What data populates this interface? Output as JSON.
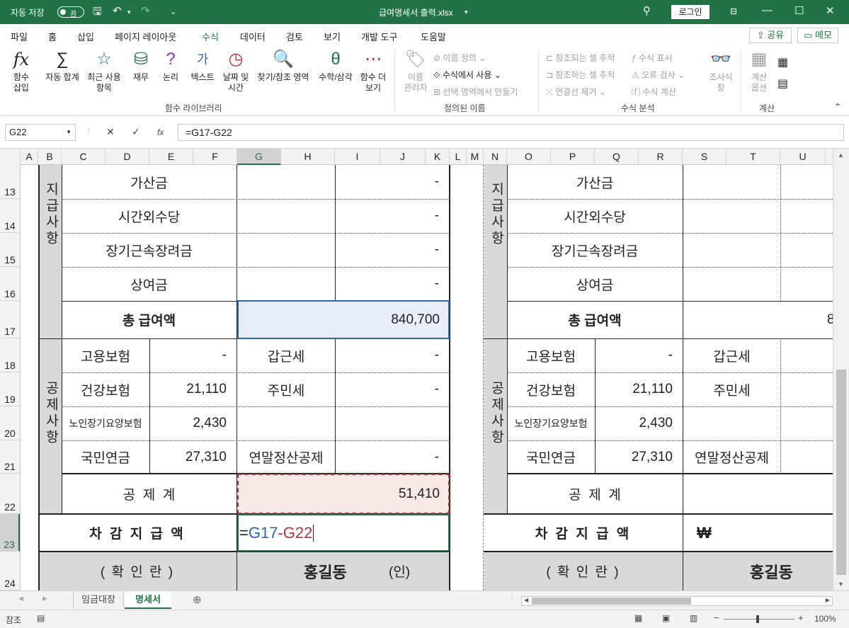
{
  "title_bar": {
    "autosave_label": "자동 저장",
    "autosave_state": "끔",
    "file_name": "급여명세서 출력.xlsx",
    "login_label": "로그인"
  },
  "menu": {
    "tabs": [
      "파일",
      "홈",
      "삽입",
      "페이지 레이아웃",
      "수식",
      "데이터",
      "검토",
      "보기",
      "개발 도구",
      "도움말"
    ],
    "active": "수식",
    "share_label": "공유",
    "memo_label": "메모"
  },
  "ribbon": {
    "function_library": {
      "insert_function": "함수\n삽입",
      "autosum": "자동 합계",
      "recent": "최근 사용\n항목",
      "financial": "재무",
      "logical": "논리",
      "text": "텍스트",
      "datetime": "날짜 및\n시간",
      "lookup": "찾기/참조 영역",
      "math": "수학/삼각",
      "more": "함수 더\n보기",
      "label": "함수 라이브러리"
    },
    "defined_names": {
      "name_manager": "이름\n관리자",
      "define_name": "이름 정의",
      "use_in_formula": "수식에서 사용",
      "create_from_selection": "선택 영역에서 만들기",
      "label": "정의된 이름"
    },
    "formula_auditing": {
      "trace_precedents": "참조되는 셀 추적",
      "trace_dependents": "참조하는 셀 추적",
      "remove_arrows": "연결선 제거",
      "show_formulas": "수식 표시",
      "error_checking": "오류 검사",
      "evaluate_formula": "수식 계산",
      "watch_window": "조사식\n창",
      "label": "수식 분석"
    },
    "calculation": {
      "options": "계산\n옵션",
      "label": "계산"
    }
  },
  "formula_bar": {
    "name_box": "G22",
    "formula": "=G17-G22"
  },
  "columns": [
    "A",
    "B",
    "C",
    "D",
    "E",
    "F",
    "G",
    "H",
    "I",
    "J",
    "K",
    "L",
    "M",
    "N",
    "O",
    "P",
    "Q",
    "R",
    "S",
    "T",
    "U"
  ],
  "rows": [
    "13",
    "14",
    "15",
    "16",
    "17",
    "18",
    "19",
    "20",
    "21",
    "22",
    "23",
    "24"
  ],
  "sheet": {
    "left": {
      "sec_pay": "지급사항",
      "sec_ded": "공제사항",
      "r13_label": "가산금",
      "r13_val": "-",
      "r14_label": "시간외수당",
      "r14_val": "-",
      "r15_label": "장기근속장려금",
      "r15_val": "-",
      "r16_label": "상여금",
      "r16_val": "-",
      "r17_label": "총 급여액",
      "r17_val": "840,700",
      "r18_l1": "고용보험",
      "r18_v1": "-",
      "r18_l2": "갑근세",
      "r18_v2": "-",
      "r19_l1": "건강보험",
      "r19_v1": "21,110",
      "r19_l2": "주민세",
      "r19_v2": "-",
      "r20_l1": "노인장기요양보험",
      "r20_v1": "2,430",
      "r21_l1": "국민연금",
      "r21_v1": "27,310",
      "r21_l2": "연말정산공제",
      "r21_v2": "-",
      "r22_label": "공  제  계",
      "r22_val": "51,410",
      "r23_label": "차 감 지 급 액",
      "r24_label": "( 확 인 란 )",
      "r24_name": "홍길동",
      "r24_seal": "(인)"
    },
    "edit_ref1": "G17",
    "edit_ref2": "G22",
    "right": {
      "sec_pay": "지급사항",
      "sec_ded": "공제사항",
      "r13_label": "가산금",
      "r14_label": "시간외수당",
      "r15_label": "장기근속장려금",
      "r16_label": "상여금",
      "r17_label": "총 급여액",
      "r17_val": "8",
      "r18_l1": "고용보험",
      "r18_v1": "-",
      "r18_l2": "갑근세",
      "r19_l1": "건강보험",
      "r19_v1": "21,110",
      "r19_l2": "주민세",
      "r20_l1": "노인장기요양보험",
      "r20_v1": "2,430",
      "r21_l1": "국민연금",
      "r21_v1": "27,310",
      "r21_l2": "연말정산공제",
      "r22_label": "공  제  계",
      "r23_label": "차 감 지 급 액",
      "r23_val": "₩",
      "r24_label": "( 확 인 란 )",
      "r24_name": "홍길동"
    }
  },
  "sheet_tabs": [
    "임금대장",
    "명세서"
  ],
  "active_sheet": "명세서",
  "status": {
    "mode": "참조",
    "zoom": "100%"
  },
  "colors": {
    "excel_green": "#217346",
    "selection_fill": "#e7eefa",
    "ref_fill": "#f8e8e8",
    "ref_blue": "#2e64b4",
    "ref_red": "#b43737",
    "header_fill": "#d9d9d9"
  }
}
